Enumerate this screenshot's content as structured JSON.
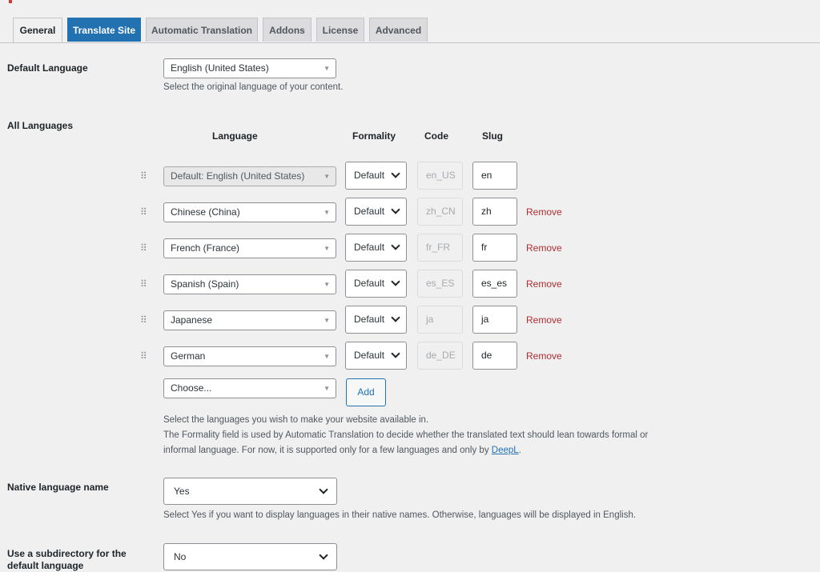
{
  "tabs": [
    {
      "label": "General"
    },
    {
      "label": "Translate Site"
    },
    {
      "label": "Automatic Translation"
    },
    {
      "label": "Addons"
    },
    {
      "label": "License"
    },
    {
      "label": "Advanced"
    }
  ],
  "default_language": {
    "label": "Default Language",
    "value": "English (United States)",
    "description": "Select the original language of your content."
  },
  "all_languages": {
    "label": "All Languages",
    "headers": {
      "language": "Language",
      "formality": "Formality",
      "code": "Code",
      "slug": "Slug"
    },
    "rows": [
      {
        "language": "Default: English (United States)",
        "formality": "Default",
        "code": "en_US",
        "slug": "en",
        "remove": ""
      },
      {
        "language": "Chinese (China)",
        "formality": "Default",
        "code": "zh_CN",
        "slug": "zh",
        "remove": "Remove"
      },
      {
        "language": "French (France)",
        "formality": "Default",
        "code": "fr_FR",
        "slug": "fr",
        "remove": "Remove"
      },
      {
        "language": "Spanish (Spain)",
        "formality": "Default",
        "code": "es_ES",
        "slug": "es_es",
        "remove": "Remove"
      },
      {
        "language": "Japanese",
        "formality": "Default",
        "code": "ja",
        "slug": "ja",
        "remove": "Remove"
      },
      {
        "language": "German",
        "formality": "Default",
        "code": "de_DE",
        "slug": "de",
        "remove": "Remove"
      }
    ],
    "choose_placeholder": "Choose...",
    "add_label": "Add",
    "desc_line1": "Select the languages you wish to make your website available in.",
    "desc_line2": "The Formality field is used by Automatic Translation to decide whether the translated text should lean towards formal or",
    "desc_line3": "informal language. For now, it is supported only for a few languages and only by ",
    "deepl_link": "DeepL",
    "desc_line3_end": "."
  },
  "native_name": {
    "label": "Native language name",
    "value": "Yes",
    "description": "Select Yes if you want to display languages in their native names. Otherwise, languages will be displayed in English."
  },
  "subdirectory": {
    "label_line1": "Use a subdirectory for the",
    "label_line2": "default language",
    "value": "No"
  },
  "colors": {
    "accent": "#2271b1",
    "remove": "#b32d2e",
    "background": "#f0f0f1"
  }
}
